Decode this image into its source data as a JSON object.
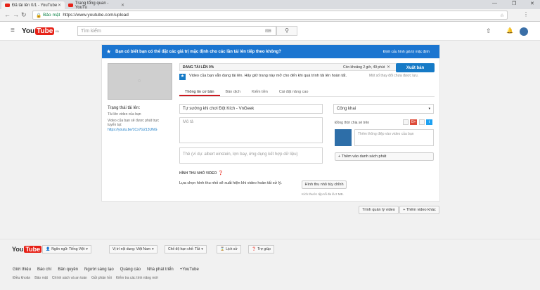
{
  "browser": {
    "tabs": [
      {
        "label": "Đã tải lên 0/1 - YouTube"
      },
      {
        "label": "Trang tổng quan - YouTu"
      }
    ],
    "secure_label": "Bảo mật",
    "url": "https://www.youtube.com/upload"
  },
  "header": {
    "logo_text": "YouTube",
    "logo_region": "VN",
    "search_placeholder": "Tìm kiếm"
  },
  "banner": {
    "text": "Bạn có biết bạn có thể đặt các giá trị mặc định cho các lần tải lên tiếp theo không?",
    "link": "Định cấu hình giá trị mặc định"
  },
  "upload": {
    "status": "ĐANG TẢI LÊN 0%",
    "progress_percent": 0,
    "time_left": "Còn khoảng 2 giờ, 49 phút",
    "publish_label": "Xuất bản",
    "notice": "Video của bạn vẫn đang tải lên. Hãy giữ trang này mở cho đến khi quá trình tải lên hoàn tất.",
    "unsaved": "Một số thay đổi chưa được lưu."
  },
  "tabs": [
    "Thông tin cơ bản",
    "Bản dịch",
    "Kiếm tiền",
    "Cài đặt nâng cao"
  ],
  "left_info": {
    "title": "Trạng thái tải lên:",
    "line1": "Tải lên video của bạn",
    "line2": "Video của bạn sẽ được phát trực tuyến tại:",
    "link": "https://youtu.be/1Cx7G213UNG"
  },
  "form": {
    "title_value": "Tự sướng khi chơi Đột Kích - VnGeek",
    "desc_placeholder": "Mô tả",
    "tags_placeholder": "Thẻ (ví dụ: albert einstein, lợn bay, ứng dụng kết hợp dữ liệu)",
    "privacy": "Công khai",
    "share_label": "Đồng thời chia sẻ trên",
    "share_placeholder": "Thêm thông điệp vào video của bạn",
    "add_playlist": "+ Thêm vào danh sách phát",
    "thumb_heading": "HÌNH THU NHỎ VIDEO",
    "thumb_text": "Lựa chọn hình thu nhỏ sẽ xuất hiện khi video hoàn tất xử lý.",
    "custom_thumb": "Hình thu nhỏ tùy chỉnh",
    "max_size": "Kích thước tệp tối đa là 2 MB."
  },
  "bottom_buttons": {
    "manager": "Trình quản lý video",
    "add_more": "+ Thêm video khác"
  },
  "footer": {
    "buttons": [
      "Ngôn ngữ: Tiếng Việt",
      "Vị trí nội dung: Việt Nam",
      "Chế độ hạn chế: Tắt",
      "Lịch sử",
      "Trợ giúp"
    ],
    "links": [
      "Giới thiệu",
      "Báo chí",
      "Bản quyền",
      "Người sáng tạo",
      "Quảng cáo",
      "Nhà phát triển",
      "+YouTube"
    ],
    "links2": [
      "Điều khoản",
      "Bảo mật",
      "Chính sách và an toàn",
      "Gửi phản hồi",
      "Kiểm tra các tính năng mới"
    ]
  }
}
